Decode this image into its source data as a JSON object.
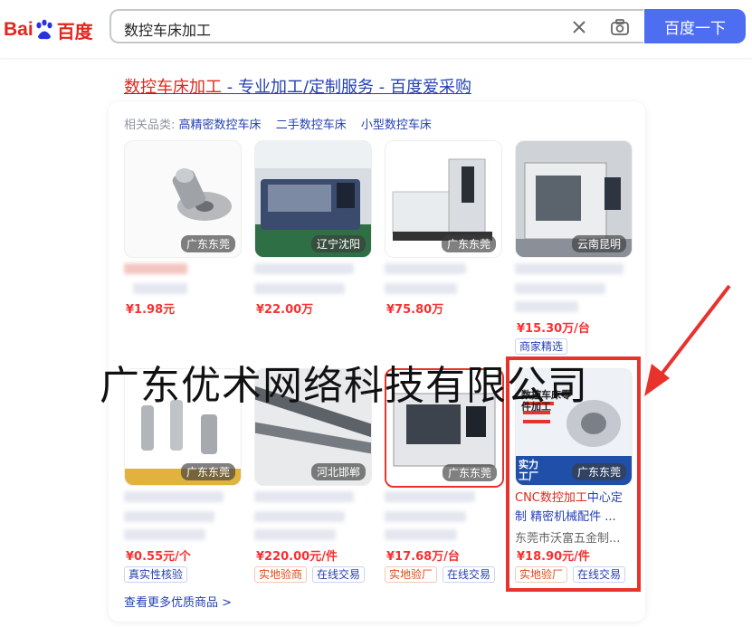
{
  "header": {
    "logo_bai": "Bai",
    "logo_du": "du",
    "logo_cn": "百度",
    "query": "数控车床加工",
    "search_button": "百度一下"
  },
  "ad": {
    "title_keyword": "数控车床加工",
    "title_rest": " - 专业加工/定制服务 - 百度爱采购",
    "related_label": "相关品类:",
    "related": [
      "高精密数控车床",
      "二手数控车床",
      "小型数控车床"
    ]
  },
  "products_row1": [
    {
      "location": "广东东莞",
      "price": "¥1.98元"
    },
    {
      "location": "辽宁沈阳",
      "price": "¥22.00万"
    },
    {
      "location": "广东东莞",
      "price": "¥75.80万"
    },
    {
      "location": "云南昆明",
      "price": "¥15.30万/台",
      "tags": [
        "商家精选"
      ]
    }
  ],
  "products_row2": [
    {
      "location": "广东东莞",
      "price": "¥0.55元/个",
      "tags": [
        "真实性核验"
      ]
    },
    {
      "location": "河北邯郸",
      "price": "¥220.00元/件",
      "tags": [
        "实地验商",
        "在线交易"
      ]
    },
    {
      "location": "广东东莞",
      "price": "¥17.68万/台",
      "tags": [
        "实地验厂",
        "在线交易"
      ]
    },
    {
      "location": "广东东莞",
      "name_keyword": "CNC数控加工",
      "name_rest": "中心定制 精密机械配件 ...",
      "shop": "东莞市沃富五金制...",
      "price": "¥18.90元/件",
      "tags": [
        "实地验厂",
        "在线交易"
      ],
      "badge": "实力工厂",
      "thumb_title": "数控车床零件加工"
    }
  ],
  "more_link": "查看更多优质商品 >",
  "watermark": "广东优术网络科技有限公司",
  "accent_color": "#4e6ef2",
  "highlight_color": "#e8332c"
}
